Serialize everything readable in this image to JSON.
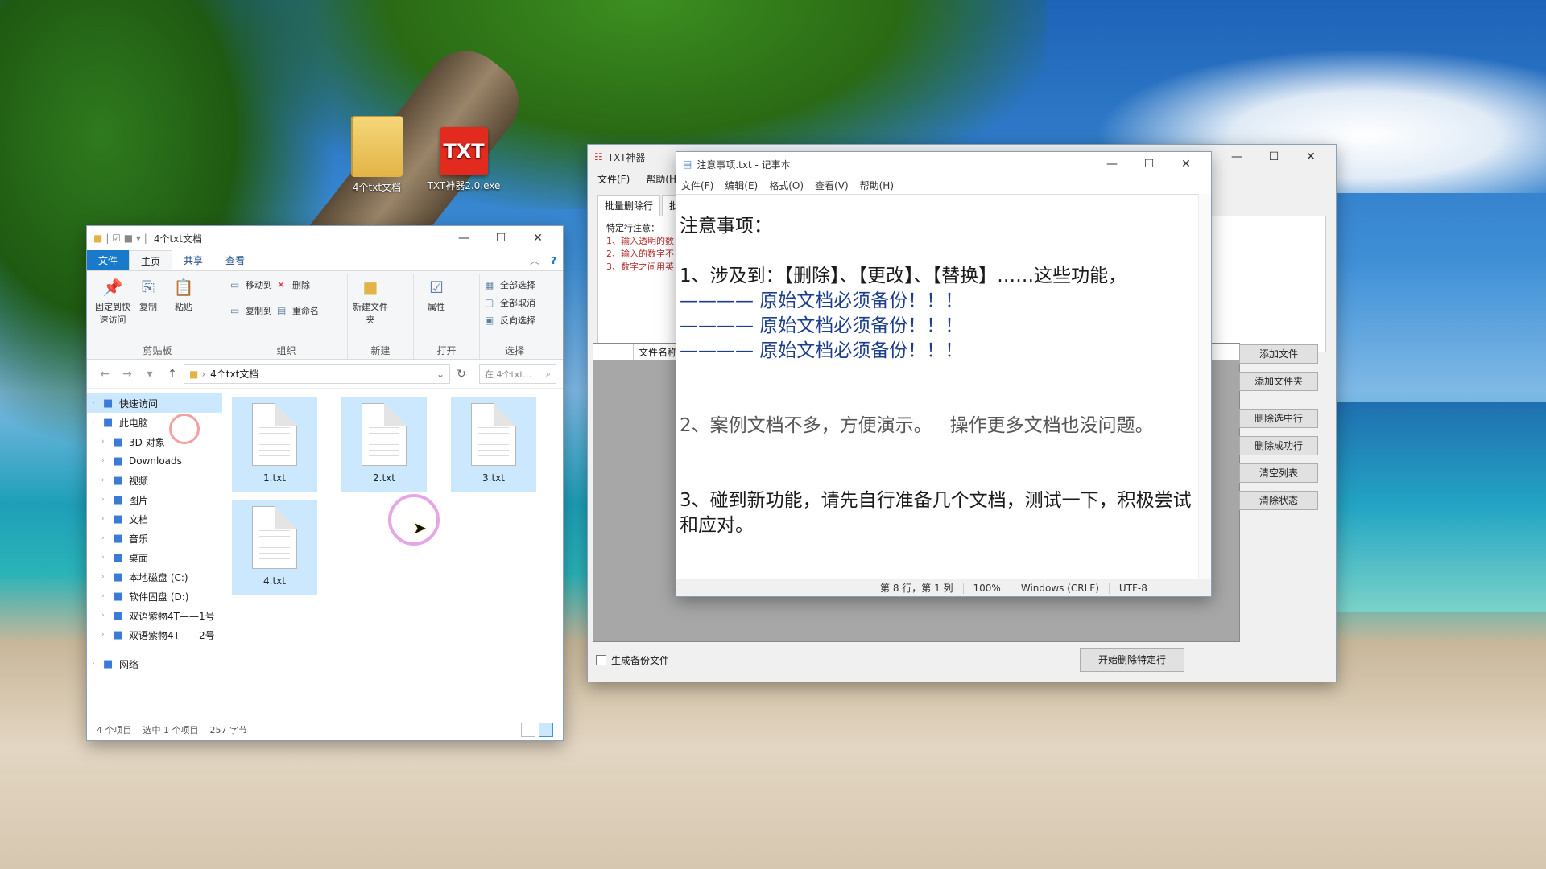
{
  "desktop": {
    "icons": [
      {
        "label": "4个txt文档",
        "icon": "folder-icon"
      },
      {
        "label": "TXT神器2.0.exe",
        "icon": "txt-app-icon",
        "badge": "TXT"
      }
    ]
  },
  "explorer": {
    "title": "4个txt文档",
    "ribbon_tabs": [
      "文件",
      "主页",
      "共享",
      "查看"
    ],
    "groups": {
      "clipboard": {
        "name": "剪贴板",
        "pin": "固定到快速访问",
        "copy": "复制",
        "paste": "粘贴"
      },
      "organize": {
        "name": "组织",
        "move": "移动到",
        "copy_to": "复制到",
        "delete": "删除",
        "rename": "重命名"
      },
      "new": {
        "name": "新建",
        "new_folder": "新建文件夹"
      },
      "open": {
        "name": "打开",
        "properties": "属性"
      },
      "select": {
        "name": "选择",
        "select_all": "全部选择",
        "select_none": "全部取消",
        "invert": "反向选择"
      }
    },
    "address": "4个txt文档",
    "search_placeholder": "在 4个txt...",
    "nav": [
      {
        "label": "快速访问",
        "icon": "star-icon",
        "level": 1,
        "selected": true
      },
      {
        "label": "此电脑",
        "icon": "computer-icon",
        "level": 1
      },
      {
        "label": "3D 对象",
        "icon": "cube-icon",
        "level": 2
      },
      {
        "label": "Downloads",
        "icon": "download-icon",
        "level": 2
      },
      {
        "label": "视频",
        "icon": "video-icon",
        "level": 2
      },
      {
        "label": "图片",
        "icon": "picture-icon",
        "level": 2
      },
      {
        "label": "文档",
        "icon": "document-icon",
        "level": 2
      },
      {
        "label": "音乐",
        "icon": "music-icon",
        "level": 2
      },
      {
        "label": "桌面",
        "icon": "desktop-icon",
        "level": 2
      },
      {
        "label": "本地磁盘 (C:)",
        "icon": "drive-icon",
        "level": 2
      },
      {
        "label": "软件固盘 (D:)",
        "icon": "drive-icon",
        "level": 2
      },
      {
        "label": "双语紫物4T——1号",
        "icon": "drive-icon",
        "level": 2
      },
      {
        "label": "双语紫物4T——2号",
        "icon": "drive-icon",
        "level": 2
      },
      {
        "label": "网络",
        "icon": "network-icon",
        "level": 1
      }
    ],
    "files": [
      "1.txt",
      "2.txt",
      "3.txt",
      "4.txt"
    ],
    "status": {
      "count": "4 个项目",
      "selected": "选中 1 个项目",
      "size": "257 字节"
    }
  },
  "txttool": {
    "title": "TXT神器",
    "menu": [
      "文件(F)",
      "帮助(H)"
    ],
    "tabs": [
      "批量删除行",
      "批量"
    ],
    "notes": {
      "heading": "特定行注意：",
      "lines": [
        "1、输入透明的数",
        "2、输入的数字不",
        "3、数字之间用英"
      ]
    },
    "grid_header": [
      "",
      "文件名称"
    ],
    "buttons": [
      "添加文件",
      "添加文件夹",
      "删除选中行",
      "删除成功行",
      "清空列表",
      "清除状态"
    ],
    "backup_label": "生成备份文件",
    "start_button": "开始删除特定行"
  },
  "notepad": {
    "title": "注意事项.txt - 记事本",
    "menu": [
      "文件(F)",
      "编辑(E)",
      "格式(O)",
      "查看(V)",
      "帮助(H)"
    ],
    "content": {
      "heading": "注意事项：",
      "line1": "1、涉及到：【删除】、【更改】、【替换】……这些功能，",
      "backup1": "———— 原始文档必须备份！！！",
      "backup2": "———— 原始文档必须备份！！！",
      "backup3": "———— 原始文档必须备份！！！",
      "line2": "2、案例文档不多，方便演示。   操作更多文档也没问题。",
      "line3": "3、碰到新功能，请先自行准备几个文档，测试一下，积极尝试和应对。"
    },
    "status": {
      "position": "第 8 行，第 1 列",
      "zoom": "100%",
      "eol": "Windows (CRLF)",
      "encoding": "UTF-8"
    }
  },
  "colors": {
    "accent": "#1979ca",
    "selection": "#cce8ff",
    "ring_pink": "#e6a6e6",
    "ring_red": "#f2a0a0"
  }
}
